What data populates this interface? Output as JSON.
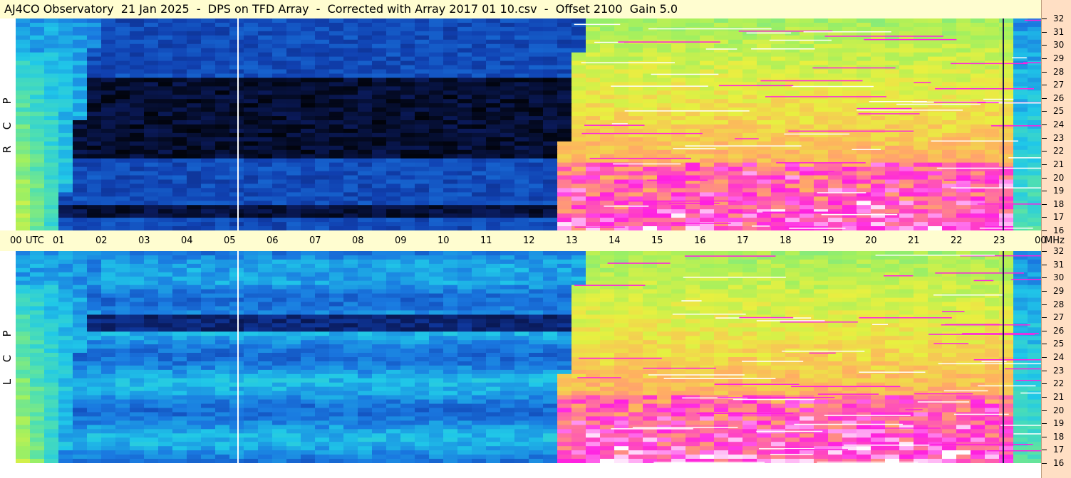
{
  "title": "AJ4CO Observatory  21 Jan 2025  -  DPS on TFD Array  -  Corrected with Array 2017 01 10.csv  -  Offset 2100  Gain 5.0",
  "chart_data": {
    "type": "heatmap",
    "panels": [
      {
        "polarization_letters": [
          "R",
          "C",
          "P"
        ]
      },
      {
        "polarization_letters": [
          "L",
          "C",
          "P"
        ]
      }
    ],
    "x_axis": {
      "tick_labels": [
        "00",
        "UTC",
        "01",
        "02",
        "03",
        "04",
        "05",
        "06",
        "07",
        "08",
        "09",
        "10",
        "11",
        "12",
        "13",
        "14",
        "15",
        "16",
        "17",
        "18",
        "19",
        "20",
        "21",
        "22",
        "23",
        "00",
        "MHz"
      ],
      "hours": [
        0,
        1,
        2,
        3,
        4,
        5,
        6,
        7,
        8,
        9,
        10,
        11,
        12,
        13,
        14,
        15,
        16,
        17,
        18,
        19,
        20,
        21,
        22,
        23,
        24
      ],
      "unit_label_time": "UTC",
      "unit_label_freq": "MHz"
    },
    "y_axis": {
      "tick_labels": [
        "32",
        "31",
        "30",
        "29",
        "28",
        "27",
        "26",
        "25",
        "24",
        "23",
        "22",
        "21",
        "20",
        "19",
        "18",
        "17",
        "16"
      ],
      "range_mhz": [
        16,
        32
      ]
    },
    "colormap": [
      "#000000",
      "#0a1a5a",
      "#1040b0",
      "#1a78e0",
      "#20c8e8",
      "#50e0b0",
      "#a0f060",
      "#e8f040",
      "#ffb060",
      "#ff70a0",
      "#ff20e0",
      "#ffffff"
    ],
    "features": {
      "vertical_lines_hours": [
        5.2,
        23.1
      ],
      "day_start_hour": 13.3,
      "night_end_hour": 1.0
    }
  }
}
